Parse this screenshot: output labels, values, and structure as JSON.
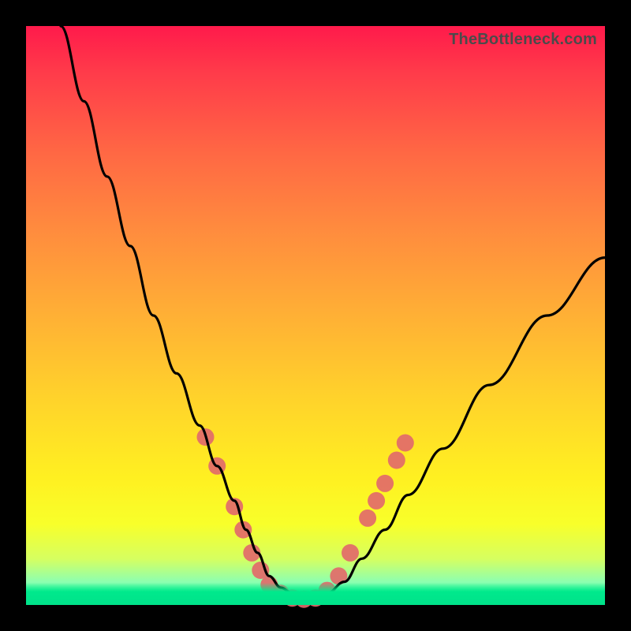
{
  "watermark": "TheBottleneck.com",
  "chart_data": {
    "type": "line",
    "title": "",
    "xlabel": "",
    "ylabel": "",
    "xlim": [
      0,
      100
    ],
    "ylim": [
      0,
      100
    ],
    "background_gradient": {
      "top": "#ff1a4b",
      "mid": "#ffd22b",
      "bottom": "#00ff8e"
    },
    "series": [
      {
        "name": "bottleneck-curve",
        "color": "#000000",
        "x": [
          6,
          10,
          14,
          18,
          22,
          26,
          30,
          33,
          36,
          38,
          40,
          42,
          44,
          46,
          48,
          50,
          52,
          55,
          58,
          62,
          66,
          72,
          80,
          90,
          100
        ],
        "y": [
          100,
          87,
          74,
          62,
          50,
          40,
          31,
          24,
          18,
          13,
          9,
          5,
          3,
          2,
          1,
          1,
          2,
          4,
          8,
          13,
          19,
          27,
          38,
          50,
          60
        ]
      }
    ],
    "markers": {
      "name": "highlight-dots",
      "color": "#e26a6a",
      "radius": 11,
      "points": [
        {
          "x": 31,
          "y": 29
        },
        {
          "x": 33,
          "y": 24
        },
        {
          "x": 36,
          "y": 17
        },
        {
          "x": 37.5,
          "y": 13
        },
        {
          "x": 39,
          "y": 9
        },
        {
          "x": 40.5,
          "y": 6
        },
        {
          "x": 42,
          "y": 3.5
        },
        {
          "x": 44,
          "y": 2
        },
        {
          "x": 46,
          "y": 1.2
        },
        {
          "x": 48,
          "y": 1
        },
        {
          "x": 50,
          "y": 1.2
        },
        {
          "x": 52,
          "y": 2.5
        },
        {
          "x": 54,
          "y": 5
        },
        {
          "x": 56,
          "y": 9
        },
        {
          "x": 59,
          "y": 15
        },
        {
          "x": 60.5,
          "y": 18
        },
        {
          "x": 62,
          "y": 21
        },
        {
          "x": 64,
          "y": 25
        },
        {
          "x": 65.5,
          "y": 28
        }
      ]
    }
  }
}
